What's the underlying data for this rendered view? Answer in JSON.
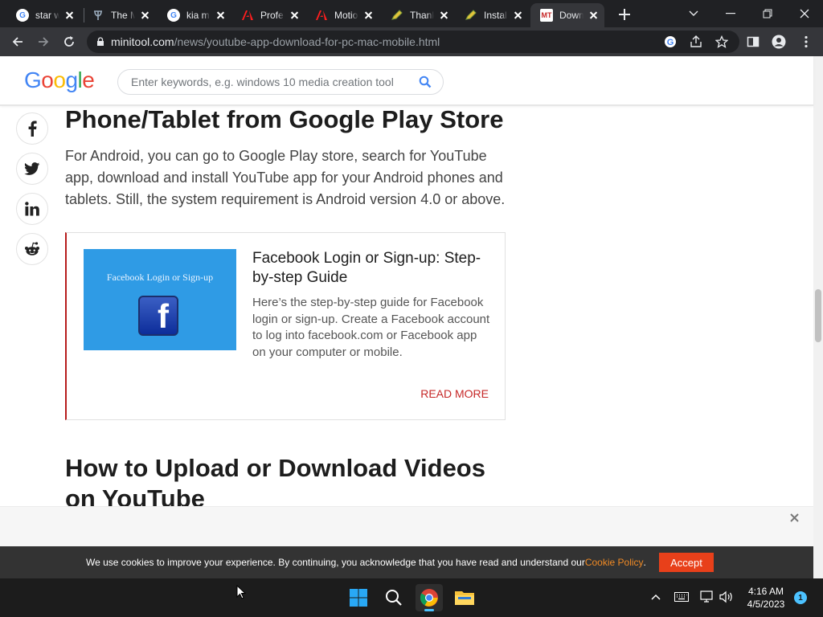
{
  "browser": {
    "tabs": [
      {
        "title": "star w",
        "favicon": "google-g-icon",
        "active": false
      },
      {
        "title": "The M",
        "favicon": "trident-icon",
        "active": false
      },
      {
        "title": "kia m",
        "favicon": "google-g-icon",
        "active": false
      },
      {
        "title": "Profe",
        "favicon": "adobe-icon",
        "active": false
      },
      {
        "title": "Motio",
        "favicon": "adobe-icon",
        "active": false
      },
      {
        "title": "Thank",
        "favicon": "pencil-icon",
        "active": false
      },
      {
        "title": "Instal",
        "favicon": "pencil-icon",
        "active": false
      },
      {
        "title": "Down",
        "favicon": "minitool-icon",
        "favicon_text": "MT",
        "active": true
      }
    ],
    "url_host": "minitool.com",
    "url_path": "/news/youtube-app-download-for-pc-mac-mobile.html"
  },
  "site": {
    "logo_letters": [
      "G",
      "o",
      "o",
      "g",
      "l",
      "e"
    ],
    "logo_colors": [
      "#4285f4",
      "#ea4335",
      "#fbbc05",
      "#4285f4",
      "#34a853",
      "#ea4335"
    ],
    "search_placeholder": "Enter keywords, e.g. windows 10 media creation tool"
  },
  "social": [
    "facebook-icon",
    "twitter-icon",
    "linkedin-icon",
    "reddit-icon"
  ],
  "article": {
    "heading": "Phone/Tablet from Google Play Store",
    "paragraph": "For Android, you can go to Google Play store, search for YouTube app, download and install YouTube app for your Android phones and tablets. Still, the system requirement is Android version 4.0 or above.",
    "card": {
      "image_caption": "Facebook Login or Sign-up",
      "image_letter": "f",
      "title": "Facebook Login or Sign-up: Step-by-step Guide",
      "description": "Here’s the step-by-step guide for Facebook login or sign-up. Create a Facebook account to log into facebook.com or Facebook app on your computer or mobile.",
      "read_more": "READ MORE"
    },
    "heading2": "How to Upload or Download Videos on YouTube"
  },
  "cookie": {
    "text": "We use cookies to improve your experience. By continuing, you acknowledge that you have read and understand our ",
    "policy_link": "Cookie Policy",
    "period": ".",
    "accept": "Accept"
  },
  "taskbar": {
    "time": "4:16 AM",
    "date": "4/5/2023",
    "notifications": "1"
  },
  "colors": {
    "accent_red": "#c62828",
    "cookie_orange": "#f08a24",
    "accept_button": "#e8401a"
  }
}
